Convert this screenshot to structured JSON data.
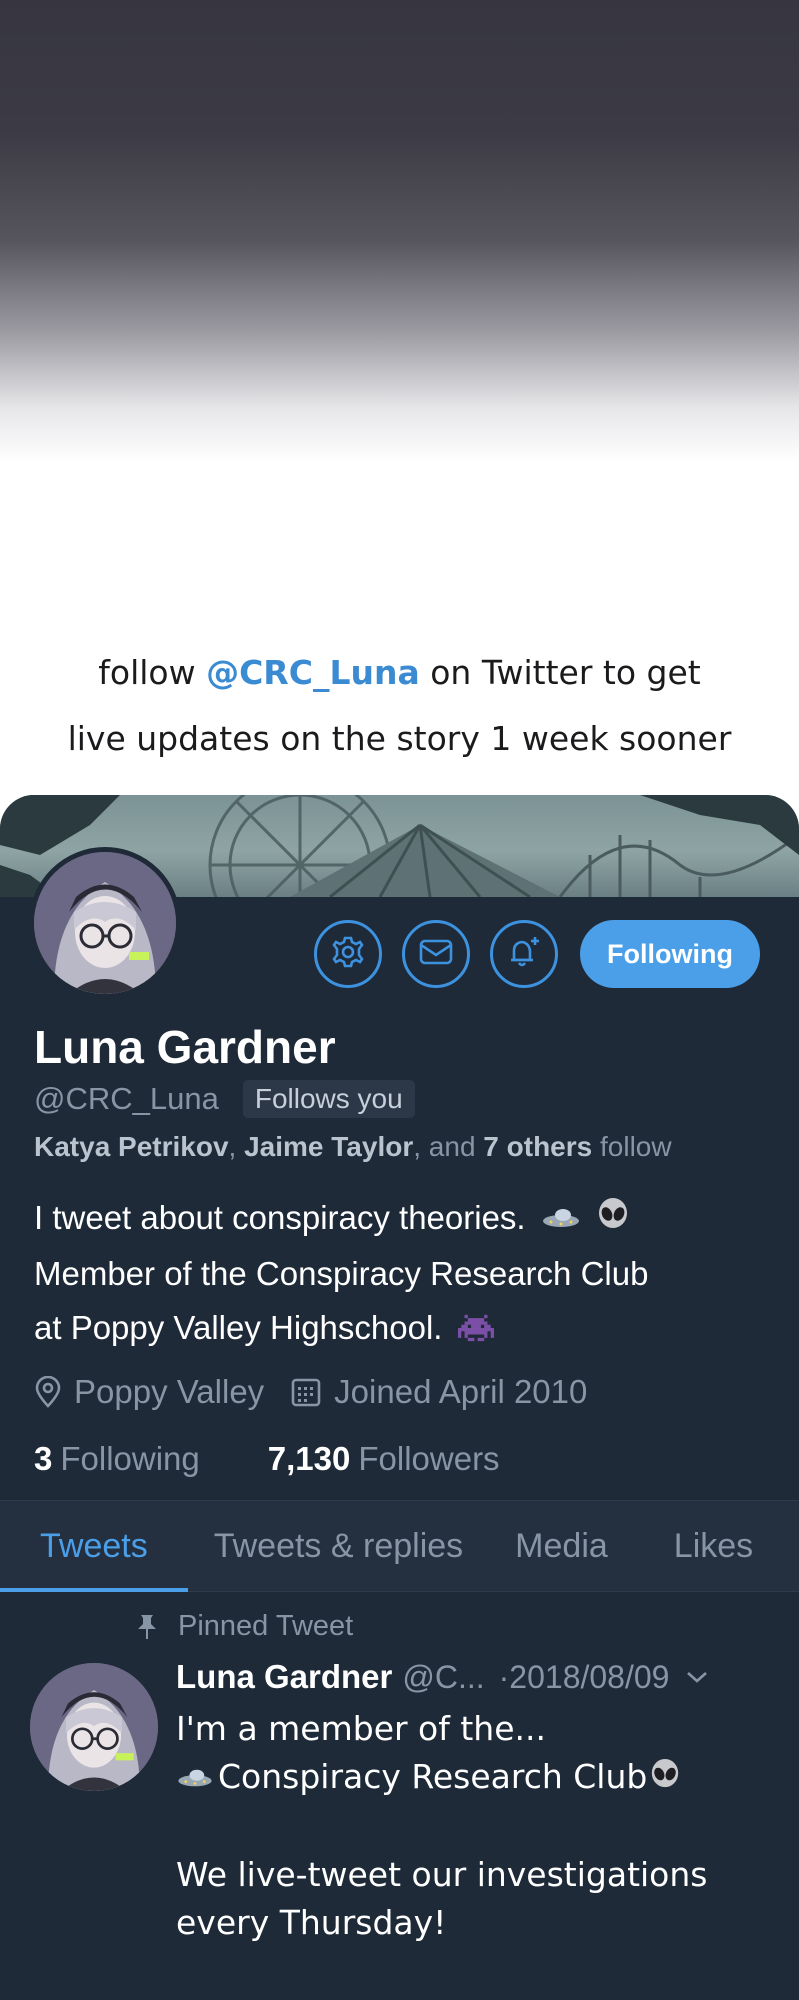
{
  "promo": {
    "line1_prefix": "follow ",
    "line1_handle": "@CRC_Luna",
    "line1_suffix": " on Twitter to get",
    "line2": "live updates on the story 1 week sooner"
  },
  "profile": {
    "name": "Luna Gardner",
    "handle": "@CRC_Luna",
    "follows_you": "Follows you",
    "mutuals": {
      "name1": "Katya Petrikov",
      "comma": ", ",
      "name2": "Jaime Taylor",
      "and": ", and ",
      "others": "7 others",
      "suffix": " follow"
    },
    "bio": [
      "I tweet about conspiracy theories.",
      "Member of the Conspiracy Research Club",
      "at Poppy Valley Highschool."
    ],
    "location": "Poppy Valley",
    "joined": "Joined April 2010",
    "following_count": "3",
    "following_label": "Following",
    "followers_count": "7,130",
    "followers_label": "Followers",
    "follow_button": "Following"
  },
  "icons": {
    "settings": "gear-icon",
    "message": "envelope-icon",
    "notify": "bell-plus-icon",
    "location": "location-pin-icon",
    "calendar": "calendar-icon",
    "pin": "pushpin-icon",
    "menu": "chevron-down-icon",
    "ufo": "flying-saucer-emoji",
    "alien": "alien-emoji",
    "invader": "space-invader-emoji"
  },
  "tabs": [
    "Tweets",
    "Tweets & replies",
    "Media",
    "Likes"
  ],
  "tweet": {
    "pinned_label": "Pinned Tweet",
    "name": "Luna Gardner",
    "handle": "@C...",
    "date": "·2018/08/09",
    "line1": "I'm a member of the...",
    "line2": "Conspiracy Research Club",
    "line3": "We live-tweet our investigations",
    "line4": "every Thursday!"
  },
  "colors": {
    "card_bg": "#1f2a38",
    "accent": "#4a9fe8",
    "secondary_text": "#8795a5",
    "promo_handle": "#3b8bd3"
  }
}
